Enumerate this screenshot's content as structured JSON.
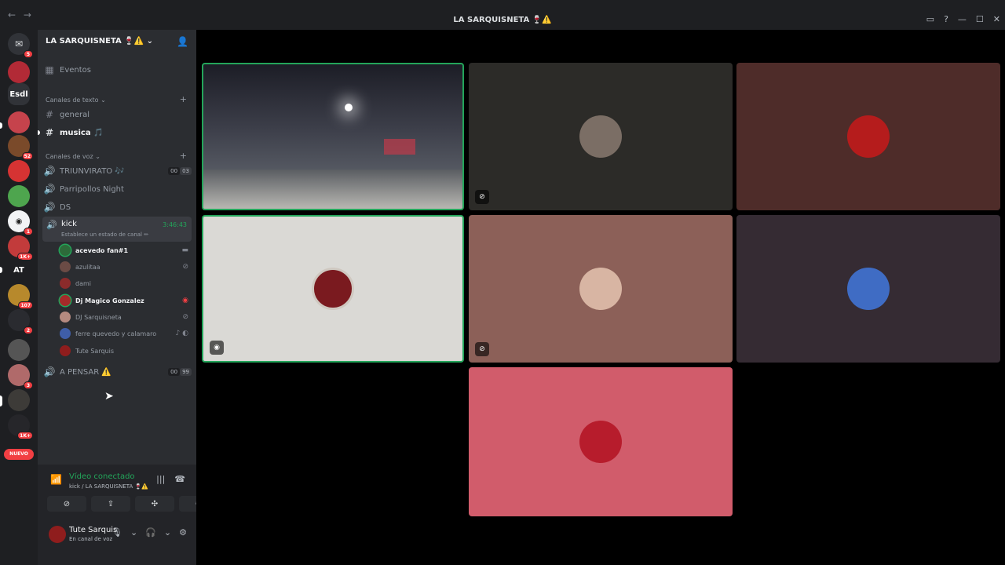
{
  "window": {
    "title": "LA SARQUISNETA 🍷⚠️",
    "nav_back": "←",
    "nav_forward": "→",
    "controls": [
      "▭",
      "?",
      "—",
      "☐",
      "✕"
    ]
  },
  "guilds": {
    "items": [
      {
        "label": "",
        "badge": "5",
        "icon": "discord-icon"
      },
      {
        "label": "",
        "badge": "",
        "icon": "server-icon"
      },
      {
        "label": "Esdl",
        "badge": "",
        "icon": "server-icon"
      },
      {
        "label": "",
        "badge": "",
        "icon": "server-icon"
      },
      {
        "label": "",
        "badge": "52",
        "icon": "server-icon"
      },
      {
        "label": "",
        "badge": "",
        "icon": "server-icon"
      },
      {
        "label": "",
        "badge": "",
        "icon": "server-icon"
      },
      {
        "label": "",
        "badge": "1",
        "icon": "server-icon"
      },
      {
        "label": "",
        "badge": "1K+",
        "icon": "server-icon"
      },
      {
        "label": "AT",
        "badge": "",
        "icon": "server-icon"
      },
      {
        "label": "",
        "badge": "107",
        "icon": "server-icon"
      },
      {
        "label": "",
        "badge": "2",
        "icon": "server-icon"
      },
      {
        "label": "",
        "badge": "",
        "icon": "server-icon"
      },
      {
        "label": "",
        "badge": "3",
        "icon": "server-icon"
      },
      {
        "label": "",
        "badge": "",
        "icon": "server-icon"
      },
      {
        "label": "",
        "badge": "1K+",
        "icon": "server-icon"
      }
    ],
    "nuevo": "NUEVO"
  },
  "server": {
    "name": "LA SARQUISNETA 🍷⚠️",
    "events": "Eventos",
    "text_category": "Canales de texto",
    "text_channels": [
      "general",
      "musica 🎵"
    ],
    "voice_category": "Canales de voz",
    "voice_channels": [
      {
        "name": "TRIUNVIRATO 🎶",
        "count_a": "00",
        "count_b": "03"
      },
      {
        "name": "Parripollos Night"
      },
      {
        "name": "DS"
      }
    ],
    "current_channel": {
      "name": "kick",
      "time": "3:46:43",
      "status": "Establece un estado de canal ✏"
    },
    "members": [
      {
        "name": "acevedo fan#1",
        "bold": true,
        "icon": "video-icon"
      },
      {
        "name": "azulitaa",
        "bold": false,
        "icon": "muted-icon"
      },
      {
        "name": "dami",
        "bold": false,
        "icon": ""
      },
      {
        "name": "Dj Magico Gonzalez",
        "bold": true,
        "icon": "live-icon"
      },
      {
        "name": "DJ Sarquisneta",
        "bold": false,
        "icon": "muted-icon"
      },
      {
        "name": "ferre quevedo y calamaro",
        "bold": false,
        "icon": "activity-icon"
      },
      {
        "name": "Tute Sarquis",
        "bold": false,
        "icon": ""
      }
    ],
    "other_voice": {
      "name": "A PENSAR ⚠️",
      "count_a": "00",
      "count_b": "99"
    }
  },
  "connection": {
    "label": "Vídeo conectado",
    "sub": "kick / LA SARQUISNETA 🍷⚠️"
  },
  "user": {
    "name": "Tute Sarquis",
    "status": "En canal de voz"
  },
  "colors": {
    "accent_green": "#23a55a",
    "tile_browns": [
      "#2c2b28",
      "#4e2c29",
      "#8c6058",
      "#352b33"
    ],
    "tile_pink": "#d15c6b",
    "tile_light": "#dad9d5"
  }
}
